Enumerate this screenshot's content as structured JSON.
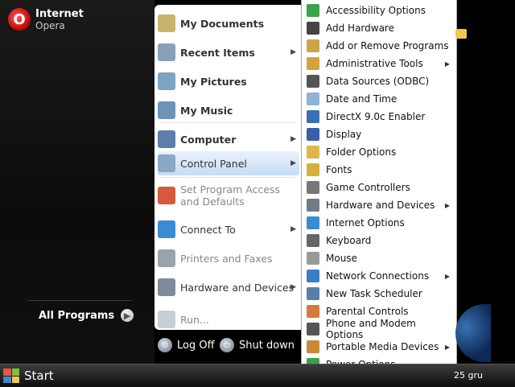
{
  "pinned": {
    "title": "Internet",
    "subtitle": "Opera"
  },
  "all_programs_label": "All Programs",
  "right_column": [
    {
      "label": "My Documents",
      "bold": true,
      "icon": "documents-icon",
      "color": "#c9b36b"
    },
    {
      "label": "Recent Items",
      "bold": true,
      "icon": "recent-items-icon",
      "color": "#8aa0b8",
      "arrow": true
    },
    {
      "label": "My Pictures",
      "bold": true,
      "icon": "pictures-icon",
      "color": "#7fa3c4"
    },
    {
      "label": "My Music",
      "bold": true,
      "icon": "music-icon",
      "color": "#6f93b8"
    },
    {
      "label": "Computer",
      "bold": true,
      "icon": "computer-icon",
      "color": "#5c7ea8",
      "arrow": true
    },
    {
      "label": "Control Panel",
      "icon": "control-panel-icon",
      "color": "#8aa8c8",
      "arrow": true,
      "highlight": true
    },
    {
      "label": "Set Program Access and Defaults",
      "icon": "defaults-icon",
      "color": "#d65a3a",
      "grey": true
    },
    {
      "label": "Connect To",
      "icon": "connect-icon",
      "color": "#3a8ad6",
      "arrow": true
    },
    {
      "label": "Printers and Faxes",
      "icon": "printers-icon",
      "color": "#9aa3ab",
      "grey": true
    },
    {
      "label": "Hardware and Devices",
      "icon": "hardware-icon",
      "color": "#7c8b99",
      "arrow": true
    },
    {
      "label": "Run...",
      "icon": "run-icon",
      "color": "#c9ced3",
      "grey": true
    }
  ],
  "actions": {
    "logoff": "Log Off",
    "shutdown": "Shut down"
  },
  "control_panel_items": [
    {
      "label": "Accessibility Options",
      "color": "#3aa34a"
    },
    {
      "label": "Add Hardware",
      "color": "#444"
    },
    {
      "label": "Add or Remove Programs",
      "color": "#c9a64a"
    },
    {
      "label": "Administrative Tools",
      "color": "#d4a43a",
      "arrow": true
    },
    {
      "label": "Data Sources (ODBC)",
      "color": "#555"
    },
    {
      "label": "Date and Time",
      "color": "#8fb2d6"
    },
    {
      "label": "DirectX 9.0c Enabler",
      "color": "#3a6fb4"
    },
    {
      "label": "Display",
      "color": "#3a5fa8"
    },
    {
      "label": "Folder Options",
      "color": "#e0b64a"
    },
    {
      "label": "Fonts",
      "color": "#d6b03a"
    },
    {
      "label": "Game Controllers",
      "color": "#777"
    },
    {
      "label": "Hardware and Devices",
      "color": "#6f7b86",
      "arrow": true
    },
    {
      "label": "Internet Options",
      "color": "#3a8ad6"
    },
    {
      "label": "Keyboard",
      "color": "#666"
    },
    {
      "label": "Mouse",
      "color": "#999"
    },
    {
      "label": "Network Connections",
      "color": "#3a7fc4",
      "arrow": true
    },
    {
      "label": "New Task Scheduler",
      "color": "#5a7fa8"
    },
    {
      "label": "Parental Controls",
      "color": "#d67a3a"
    },
    {
      "label": "Phone and Modem Options",
      "color": "#555"
    },
    {
      "label": "Portable Media Devices",
      "color": "#c98a3a",
      "arrow": true
    },
    {
      "label": "Power Options",
      "color": "#3aa34a"
    }
  ],
  "taskbar": {
    "start_label": "Start",
    "date_text": "25 gru"
  }
}
